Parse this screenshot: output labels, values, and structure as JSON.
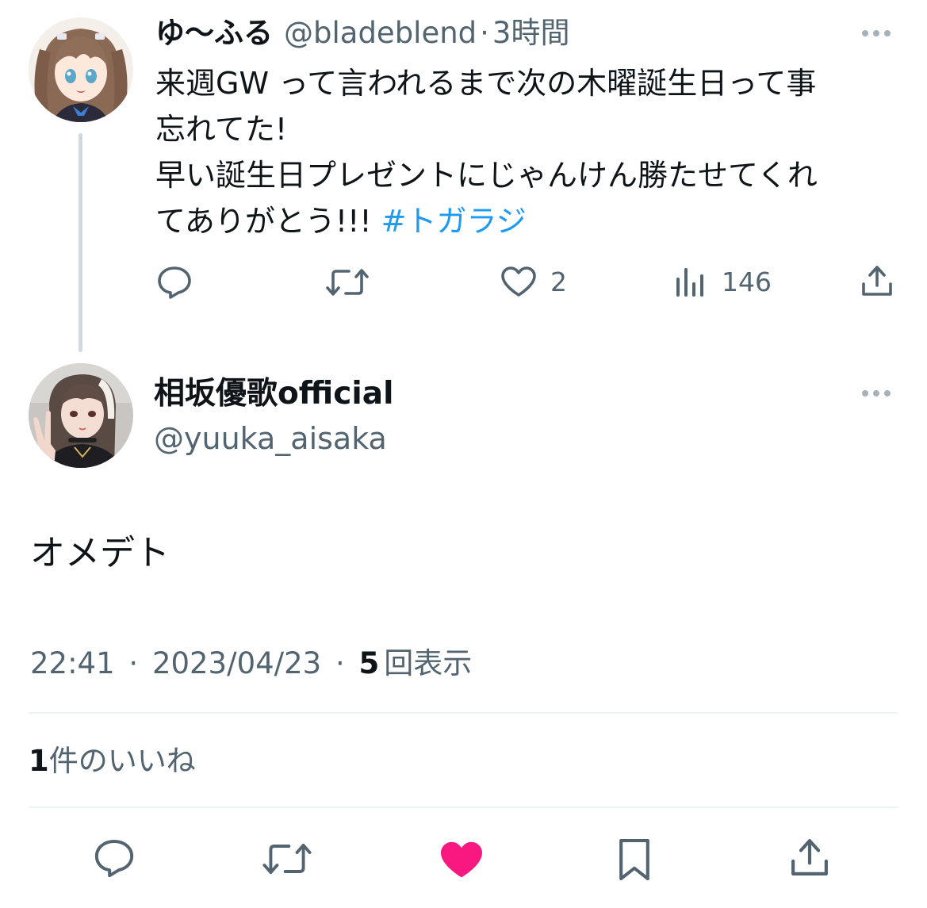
{
  "parent_tweet": {
    "display_name": "ゆ〜ふる",
    "handle": "@bladeblend",
    "separator": "·",
    "time_ago": "3時間",
    "text_lines": [
      "来週GW って言われるまで次の木曜誕生日って事",
      "忘れてた!",
      "早い誕生日プレゼントにじゃんけん勝たせてくれ"
    ],
    "text_last_line": "てありがとう!!!",
    "hashtag": "#トガラジ",
    "stats": {
      "likes": "2",
      "views": "146"
    },
    "icons": [
      "reply-icon",
      "retweet-icon",
      "like-icon",
      "views-icon",
      "share-icon",
      "more-icon"
    ]
  },
  "reply_tweet": {
    "display_name": "相坂優歌official",
    "handle": "@yuuka_aisaka",
    "text": "オメデト",
    "time": "22:41",
    "separator": "·",
    "date": "2023/04/23",
    "view_count": "5",
    "view_label": "回表示",
    "like_count": "1",
    "like_label": "件のいいね",
    "icons": [
      "reply-icon",
      "retweet-icon",
      "liked-heart-icon",
      "bookmark-icon",
      "share-icon",
      "more-icon"
    ]
  },
  "colors": {
    "hashtag": "#1d9bf0",
    "secondary_text": "#536471",
    "liked": "#f91880",
    "thread_line": "#cfd9de",
    "divider": "#eff3f4"
  }
}
